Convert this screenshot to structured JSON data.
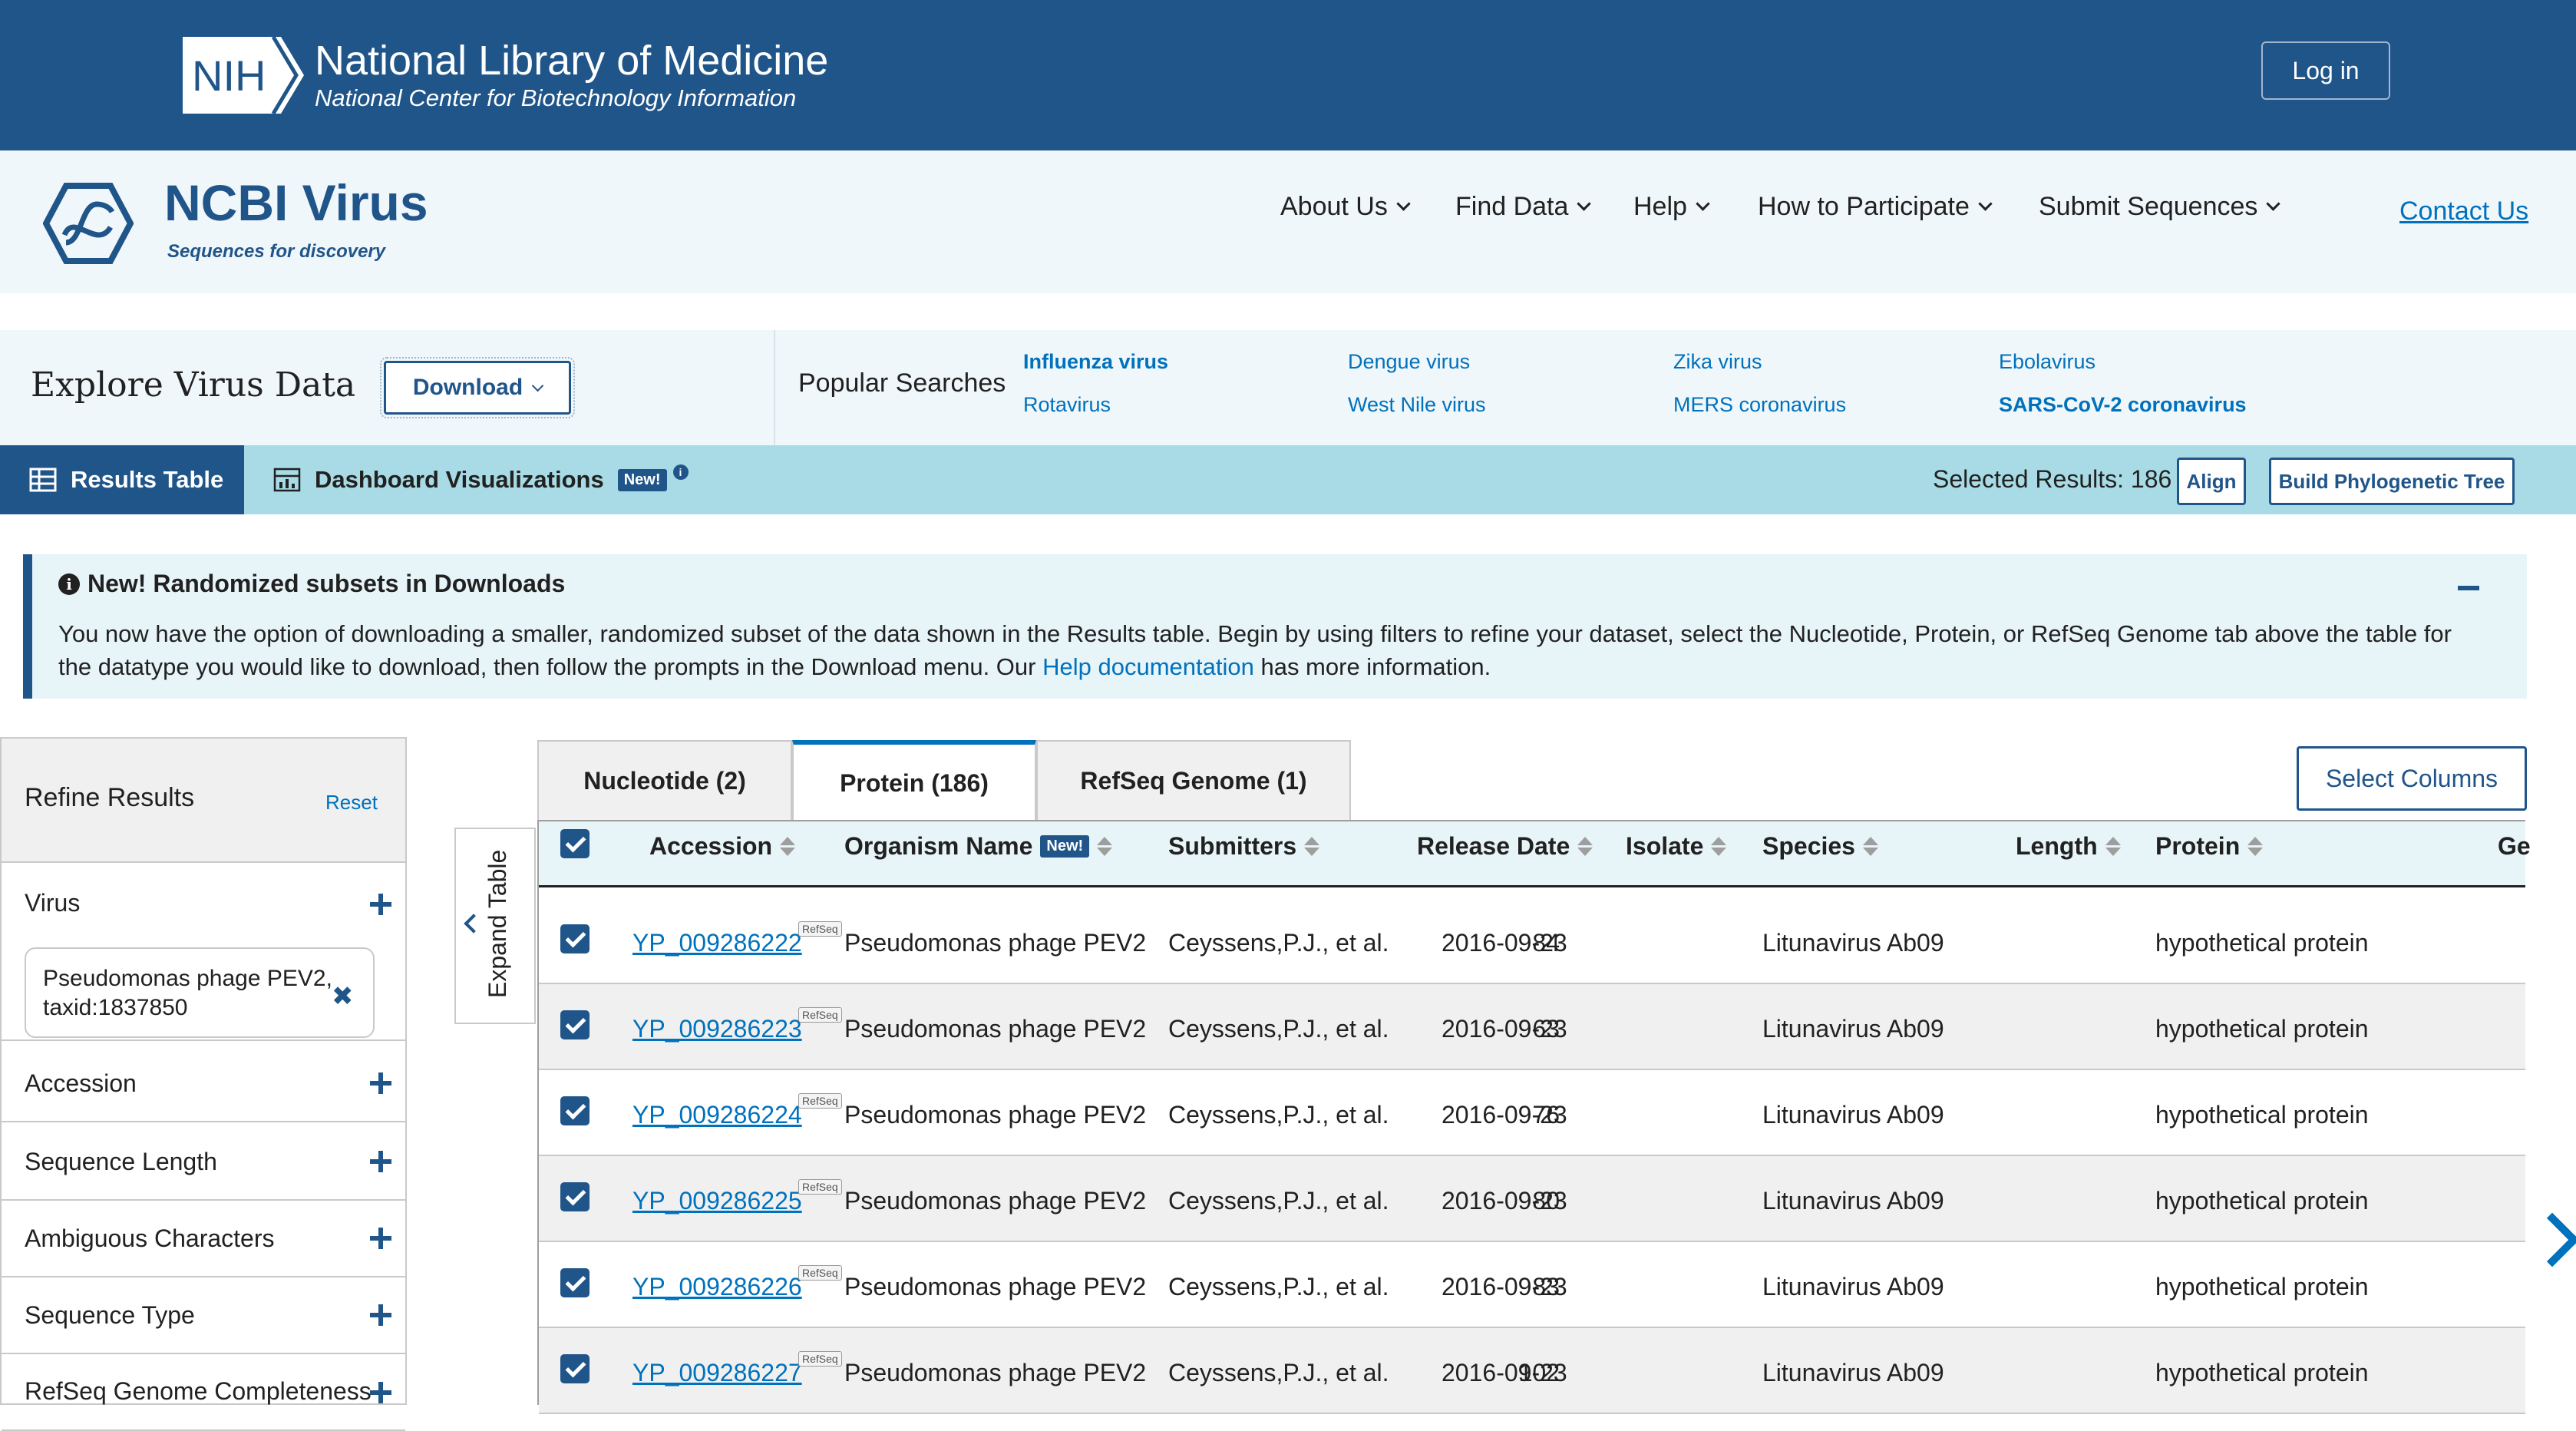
{
  "nih": {
    "logo_text": "NIH",
    "title": "National Library of Medicine",
    "subtitle": "National Center for Biotechnology Information",
    "login": "Log in"
  },
  "site": {
    "title": "NCBI Virus",
    "tagline": "Sequences for discovery",
    "nav": [
      "About Us",
      "Find Data",
      "Help",
      "How to Participate",
      "Submit Sequences"
    ],
    "contact": "Contact Us"
  },
  "explore": {
    "title": "Explore Virus Data",
    "download": "Download",
    "popular_label": "Popular Searches",
    "popular": [
      {
        "label": "Influenza virus",
        "bold": true
      },
      {
        "label": "Dengue virus",
        "bold": false
      },
      {
        "label": "Zika virus",
        "bold": false
      },
      {
        "label": "Ebolavirus",
        "bold": false
      },
      {
        "label": "Rotavirus",
        "bold": false
      },
      {
        "label": "West Nile virus",
        "bold": false
      },
      {
        "label": "MERS coronavirus",
        "bold": false
      },
      {
        "label": "SARS-CoV-2 coronavirus",
        "bold": true
      }
    ]
  },
  "tabs": {
    "results": "Results Table",
    "dashboard": "Dashboard Visualizations",
    "new_badge": "New!",
    "info": "i",
    "selected": "Selected Results: 186",
    "align": "Align",
    "tree": "Build Phylogenetic Tree"
  },
  "announcement": {
    "title": "New! Randomized subsets in Downloads",
    "body_start": "You now have the option of downloading a smaller, randomized subset of the data shown in the Results table. Begin by using filters to refine your dataset, select the Nucleotide, Protein, or RefSeq Genome tab above the table for the datatype you would like to download, then follow the prompts in the Download menu. Our ",
    "link": "Help documentation",
    "body_end": " has more information."
  },
  "sidebar": {
    "title": "Refine Results",
    "reset": "Reset",
    "virus_label": "Virus",
    "virus_filter": "Pseudomonas phage PEV2, taxid:1837850",
    "facets": [
      "Accession",
      "Sequence Length",
      "Ambiguous Characters",
      "Sequence Type",
      "RefSeq Genome Completeness"
    ]
  },
  "expand": "Expand Table",
  "data_tabs": [
    "Nucleotide (2)",
    "Protein (186)",
    "RefSeq Genome (1)"
  ],
  "select_columns": "Select Columns",
  "table": {
    "columns": [
      "Accession",
      "Organism Name",
      "Submitters",
      "Release Date",
      "Isolate",
      "Species",
      "Length",
      "Protein",
      "Ge"
    ],
    "new_badge": "New!",
    "refseq_tag": "RefSeq",
    "rows": [
      {
        "accession": "YP_009286222",
        "organism": "Pseudomonas phage PEV2",
        "submitters": "Ceyssens,P.J., et al.",
        "release": "2016-09-23",
        "isolate": "",
        "species": "Litunavirus Ab09",
        "length": "84",
        "protein": "hypothetical protein"
      },
      {
        "accession": "YP_009286223",
        "organism": "Pseudomonas phage PEV2",
        "submitters": "Ceyssens,P.J., et al.",
        "release": "2016-09-23",
        "isolate": "",
        "species": "Litunavirus Ab09",
        "length": "63",
        "protein": "hypothetical protein"
      },
      {
        "accession": "YP_009286224",
        "organism": "Pseudomonas phage PEV2",
        "submitters": "Ceyssens,P.J., et al.",
        "release": "2016-09-23",
        "isolate": "",
        "species": "Litunavirus Ab09",
        "length": "76",
        "protein": "hypothetical protein"
      },
      {
        "accession": "YP_009286225",
        "organism": "Pseudomonas phage PEV2",
        "submitters": "Ceyssens,P.J., et al.",
        "release": "2016-09-23",
        "isolate": "",
        "species": "Litunavirus Ab09",
        "length": "80",
        "protein": "hypothetical protein"
      },
      {
        "accession": "YP_009286226",
        "organism": "Pseudomonas phage PEV2",
        "submitters": "Ceyssens,P.J., et al.",
        "release": "2016-09-23",
        "isolate": "",
        "species": "Litunavirus Ab09",
        "length": "83",
        "protein": "hypothetical protein"
      },
      {
        "accession": "YP_009286227",
        "organism": "Pseudomonas phage PEV2",
        "submitters": "Ceyssens,P.J., et al.",
        "release": "2016-09-23",
        "isolate": "",
        "species": "Litunavirus Ab09",
        "length": "102",
        "protein": "hypothetical protein"
      }
    ]
  },
  "colors": {
    "brand": "#20558a",
    "link": "#0071bc",
    "tab_bar": "#a8dbe5"
  }
}
